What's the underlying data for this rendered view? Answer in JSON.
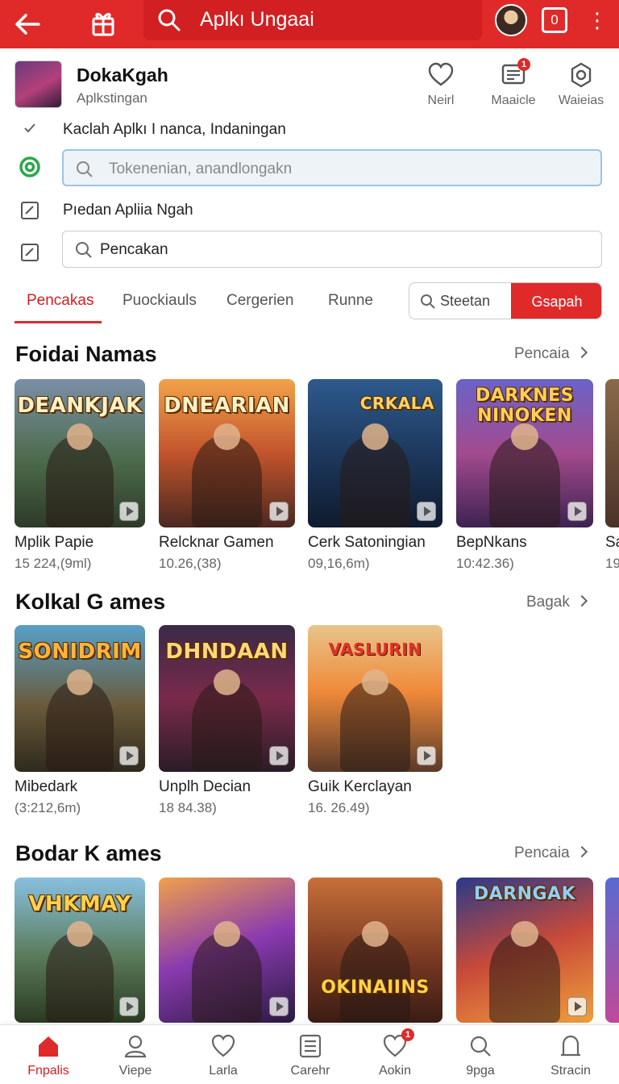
{
  "topbar": {
    "search_text": "Aplkı Ungaai",
    "square_glyph": "0",
    "icons": [
      "back-arrow-icon",
      "gift-icon",
      "search-icon",
      "avatar",
      "square-icon",
      "more-vertical-icon"
    ]
  },
  "app": {
    "name": "DokaKgah",
    "subtitle": "Aplkstingan",
    "actions": [
      {
        "label": "Neirl",
        "icon": "heart-icon"
      },
      {
        "label": "Maaicle",
        "icon": "message-icon",
        "badge": "1"
      },
      {
        "label": "Waieias",
        "icon": "settings-icon"
      }
    ]
  },
  "rows": {
    "row1_text": "Kaclah  Aplkı I nanca, Indaningan",
    "field1_placeholder": "Tokenenian, anandlongakn",
    "row3_text": "Pıedan  Apliia Ngah",
    "field2_text": "Pencakan"
  },
  "tabs": {
    "items": [
      "Pencakas",
      "Puockiauls",
      "Cergerien",
      "Runne"
    ],
    "active_index": 0,
    "search_label": "Steetan",
    "search_button": "Gsapah"
  },
  "sections": [
    {
      "title": "Foidai Namas",
      "more": "Pencaia",
      "cards": [
        {
          "art_title": "DEANKJAK",
          "name": "Mplik Papie",
          "meta": "15 224,(9ml)"
        },
        {
          "art_title": "DNEARIAN",
          "name": "Relcknar Gamen",
          "meta": "10.26,(38)"
        },
        {
          "art_title": "CRKALA",
          "name": "Cerk Satoningian",
          "meta": "09,16,6m)"
        },
        {
          "art_title": "DARKNES NINOKEN",
          "name": "BepNkans",
          "meta": "10:42.36)"
        },
        {
          "art_title": "",
          "name": "Sa",
          "meta": "19"
        }
      ]
    },
    {
      "title": "Kolkal G ames",
      "more": "Bagak",
      "cards": [
        {
          "art_title": "SONIDRIM",
          "name": "Mibedark",
          "meta": "(3:212,6m)"
        },
        {
          "art_title": "DHNDAAN",
          "name": "Unplh Decian",
          "meta": "18 84.38)"
        },
        {
          "art_title": "VASLURIN",
          "name": "Guik Kerclayan",
          "meta": "16. 26.49)"
        }
      ]
    },
    {
      "title": "Bodar K ames",
      "more": "Pencaia",
      "cards": [
        {
          "art_title": "VHKMAY"
        },
        {
          "art_title": ""
        },
        {
          "art_title": "OKINAIINS"
        },
        {
          "art_title": "DARNGAK"
        }
      ]
    }
  ],
  "bottom_nav": [
    {
      "label": "Fnpalis",
      "icon": "home-icon",
      "active": true
    },
    {
      "label": "Viepe",
      "icon": "user-icon"
    },
    {
      "label": "Larla",
      "icon": "heart-icon"
    },
    {
      "label": "Carehr",
      "icon": "list-icon"
    },
    {
      "label": "Aokin",
      "icon": "favorite-icon",
      "badge": "1"
    },
    {
      "label": "9pga",
      "icon": "search-icon"
    },
    {
      "label": "Stracin",
      "icon": "profile-icon"
    }
  ],
  "colors": {
    "accent": "#e02a2a",
    "accent_dark": "#d21f22",
    "field_active_border": "#9ec3e6",
    "field_active_bg": "#eef3f8"
  }
}
